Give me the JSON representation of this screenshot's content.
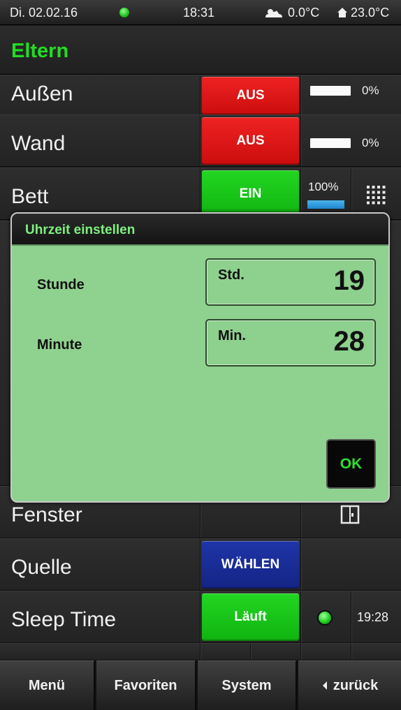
{
  "status_bar": {
    "date": "Di. 02.02.16",
    "time": "18:31",
    "outdoor_temp": "0.0°C",
    "indoor_temp": "23.0°C",
    "led_color": "#22cc22"
  },
  "header": {
    "title": "Eltern",
    "title_color": "#22dd22"
  },
  "rows": [
    {
      "label": "Außen",
      "button": "AUS",
      "level_pct": "0%"
    },
    {
      "label": "Wand",
      "button": "AUS",
      "level_pct": "0%"
    },
    {
      "label": "Bett",
      "button": "EIN",
      "level_pct": "100%"
    },
    {
      "label": "Fenster"
    },
    {
      "label": "Quelle",
      "button": "WÄHLEN"
    },
    {
      "label": "Sleep Time",
      "button": "Läuft",
      "value": "19:28"
    }
  ],
  "dialog": {
    "title": "Uhrzeit einstellen",
    "hour": {
      "label": "Stunde",
      "unit": "Std.",
      "value": "19"
    },
    "minute": {
      "label": "Minute",
      "unit": "Min.",
      "value": "28"
    },
    "ok": "OK",
    "bg_color": "#8fd18f"
  },
  "bottom_nav": {
    "menu": "Menü",
    "favorites": "Favoriten",
    "system": "System",
    "back": "zurück"
  },
  "colors": {
    "red": "#dd1515",
    "green": "#18c418",
    "blue": "#1a2d99"
  },
  "icons": [
    "weather-cloud-sun-icon",
    "house-icon",
    "grid-dots-icon",
    "window-icon",
    "chevron-left-icon"
  ]
}
